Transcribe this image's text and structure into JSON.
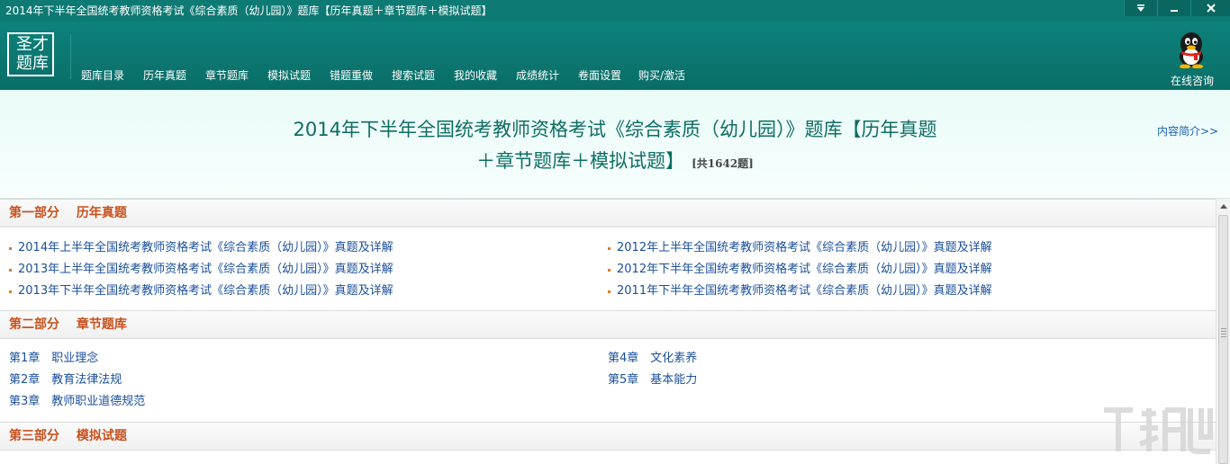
{
  "window": {
    "title": "2014年下半年全国统考教师资格考试《综合素质（幼儿园）》题库【历年真题＋章节题库＋模拟试题】"
  },
  "logo": {
    "line1": "圣才",
    "line2": "题库"
  },
  "nav": [
    "题库目录",
    "历年真题",
    "章节题库",
    "模拟试题",
    "错题重做",
    "搜索试题",
    "我的收藏",
    "成绩统计",
    "卷面设置",
    "购买/激活"
  ],
  "consult_label": "在线咨询",
  "banner": {
    "title_line1": "2014年下半年全国统考教师资格考试《综合素质（幼儿园）》题库【历年真题",
    "title_line2": "＋章节题库＋模拟试题】",
    "count": "[共1642题]",
    "intro_link": "内容简介>>"
  },
  "sections": [
    {
      "heading": "第一部分　 历年真题"
    },
    {
      "heading": "第二部分　 章节题库"
    },
    {
      "heading": "第三部分　 模拟试题"
    }
  ],
  "past_papers": {
    "left": [
      "2014年上半年全国统考教师资格考试《综合素质（幼儿园）》真题及详解",
      "2013年上半年全国统考教师资格考试《综合素质（幼儿园）》真题及详解",
      "2013年下半年全国统考教师资格考试《综合素质（幼儿园）》真题及详解"
    ],
    "right": [
      "2012年上半年全国统考教师资格考试《综合素质（幼儿园）》真题及详解",
      "2012年下半年全国统考教师资格考试《综合素质（幼儿园）》真题及详解",
      "2011年下半年全国统考教师资格考试《综合素质（幼儿园）》真题及详解"
    ]
  },
  "chapters": {
    "left": [
      "第1章　职业理念",
      "第2章　教育法律法规",
      "第3章　教师职业道德规范"
    ],
    "right": [
      "第4章　文化素养",
      "第5章　基本能力"
    ]
  },
  "icons": {
    "dropdown": "chevron-down-icon",
    "minimize": "minimize-icon",
    "close": "close-icon",
    "consult": "qq-penguin-icon",
    "watermark": "watermark-logo"
  },
  "colors": {
    "titlebar": "#0e7a74",
    "header": "#0a6d67",
    "banner_text": "#0e6d63",
    "section_heading": "#c8501c",
    "link": "#1a4f9c",
    "bullet": "#e07a20"
  }
}
